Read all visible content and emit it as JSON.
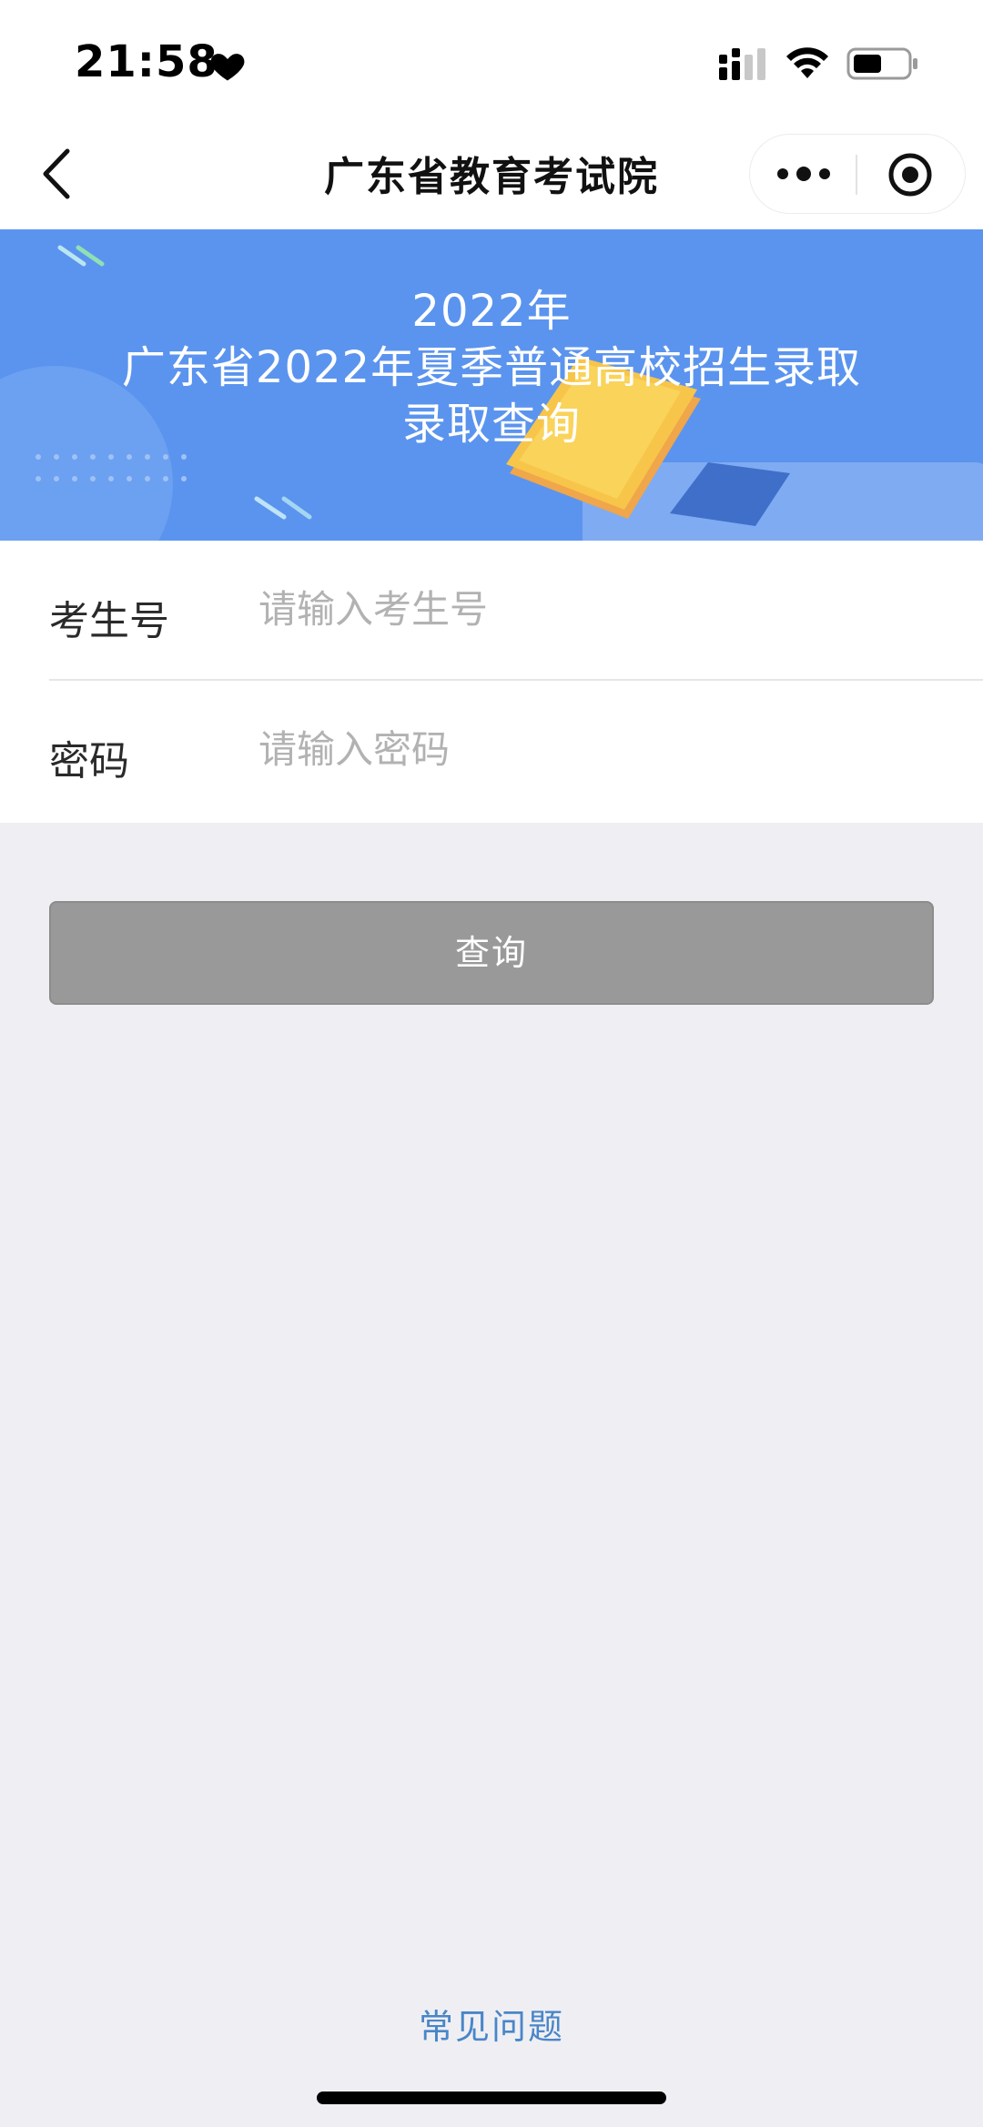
{
  "status_bar": {
    "time": "21:58"
  },
  "nav": {
    "title": "广东省教育考试院"
  },
  "banner": {
    "line1": "2022年",
    "line2": "广东省2022年夏季普通高校招生录取",
    "line3": "录取查询"
  },
  "form": {
    "exam_no_label": "考生号",
    "exam_no_placeholder": "请输入考生号",
    "password_label": "密码",
    "password_placeholder": "请输入密码"
  },
  "query_button_label": "查询",
  "faq_label": "常见问题",
  "colors": {
    "banner_blue": "#5b94ee",
    "button_disabled_gray": "#999999",
    "link_blue": "#4a86c8",
    "page_background": "#efeff3"
  },
  "icons": {
    "back": "chevron-left-icon",
    "more": "more-dots-icon",
    "close_miniprogram": "target-circle-icon",
    "status_heart": "heart-icon",
    "signal": "signal-icon",
    "wifi": "wifi-icon",
    "battery": "battery-icon"
  }
}
